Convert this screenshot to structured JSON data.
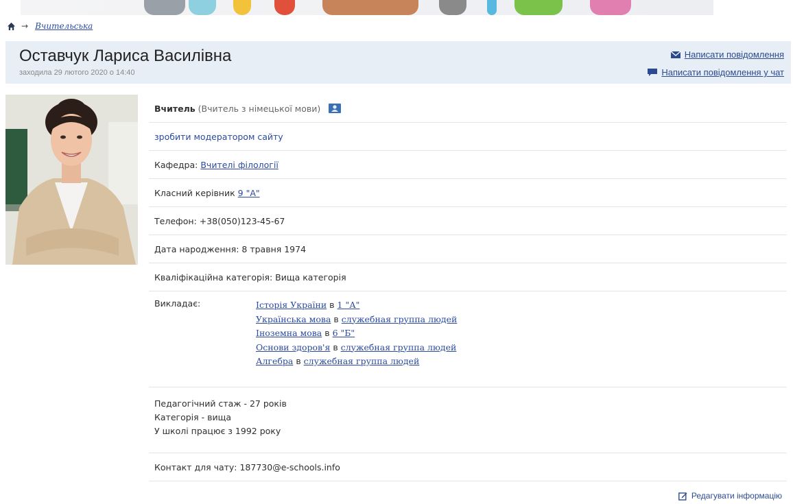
{
  "breadcrumb": {
    "current": "Вчительська"
  },
  "profile": {
    "name": "Оставчук Лариса Василівна",
    "last_seen": "заходила 29 лютого 2020 о 14:40"
  },
  "actions": {
    "message": "Написати повідомлення",
    "chat_message": "Написати повідомлення у чат",
    "edit": "Редагувати інформацію"
  },
  "info": {
    "role_bold": "Вчитель",
    "role_detail": "(Вчитель з німецької мови)",
    "make_moderator": "зробити модератором сайту",
    "department_label": "Кафедра: ",
    "department_link": "Вчителі філології",
    "class_teacher_label": "Класний керівник ",
    "class_teacher_link": "9 \"А\"",
    "phone": "Телефон: +38(050)123-45-67",
    "birth_date": "Дата народження: 8 травня 1974",
    "qualification": "Кваліфікаційна категорія: Вища категорія",
    "teaches_label": "Викладає:",
    "teaches": [
      {
        "subject": "Історія України",
        "sep": " в ",
        "group": "1 \"А\""
      },
      {
        "subject": "Українська мова",
        "sep": " в ",
        "group": "служебная группа людей"
      },
      {
        "subject": "Іноземна мова",
        "sep": " в ",
        "group": "6 \"Б\""
      },
      {
        "subject": "Основи здоров'я",
        "sep": " в ",
        "group": "служебная группа людей"
      },
      {
        "subject": "Алгебра",
        "sep": " в ",
        "group": "служебная группа людей"
      }
    ],
    "experience": [
      "Педагогічний стаж - 27 років",
      "Категорія - вища",
      "У школі працює з 1992 року"
    ],
    "chat_contact": "Контакт для чату: 187730@e-schools.info"
  },
  "colors": {
    "link": "#2b4aa0",
    "header_bg": "#e7eef6"
  },
  "icons": [
    "home-icon",
    "arrow-right-icon",
    "envelope-icon",
    "chat-icon",
    "vcard-icon",
    "edit-icon"
  ]
}
